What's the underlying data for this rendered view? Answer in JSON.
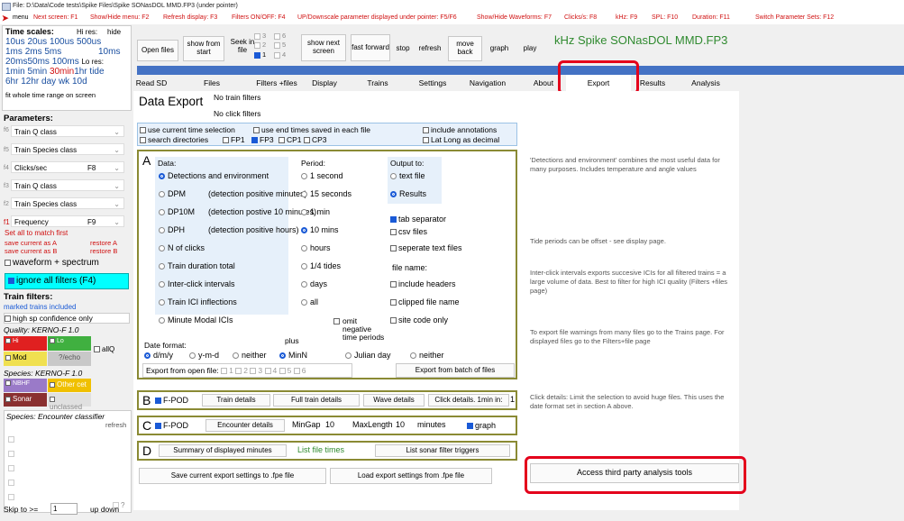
{
  "window_title": "File: D:\\Data\\Code tests\\Spike Files\\Spike SONasDOL MMD.FP3  (under pointer)",
  "menubar": {
    "menu_label": "menu",
    "hints": [
      "Next screen: F1",
      "Show/Hide menu: F2",
      "Refresh display: F3",
      "Filters ON/OFF: F4",
      "UP/Downscale parameter displayed under pointer: F5/F6",
      "Show/Hide Waveforms: F7",
      "Clicks/s: F8",
      "kHz: F9",
      "SPL: F10",
      "Duration: F11",
      "Switch Parameter Sets: F12"
    ]
  },
  "left": {
    "time_scales_label": "Time scales:",
    "hi_res": "Hi res:",
    "hide": "hide",
    "row1": [
      "10us",
      "20us",
      "100us",
      "500us"
    ],
    "row2": [
      "1ms",
      "2ms",
      "5ms",
      "10ms"
    ],
    "row3": [
      "20ms",
      "50ms",
      "100ms",
      "Lo res:"
    ],
    "row4": [
      "1min",
      "5min",
      "30min",
      "1hr",
      "tide"
    ],
    "row5": [
      "6hr",
      "12hr",
      "day",
      "wk",
      "10d"
    ],
    "fit_label": "fit whole time range on screen",
    "parameters_label": "Parameters:",
    "params": [
      {
        "code": "f6",
        "label": "Train Q class",
        "value": ""
      },
      {
        "code": "f5",
        "label": "Train Species class",
        "value": ""
      },
      {
        "code": "f4",
        "label": "Clicks/sec",
        "value": "F8"
      },
      {
        "code": "f3",
        "label": "Train Q class",
        "value": ""
      },
      {
        "code": "f2",
        "label": "Train Species class",
        "value": ""
      },
      {
        "code": "f1",
        "label": "Frequency",
        "value": "F9"
      }
    ],
    "set_all": "Set all to match first",
    "save_a": "save current as A",
    "restore_a": "restore A",
    "save_b": "save current as B",
    "restore_b": "restore B",
    "waveform_spectrum": "waveform + spectrum",
    "ignore_filters": "ignore all filters (F4)",
    "train_filters": "Train filters:",
    "marked_trains": "marked trains included",
    "high_sp": "high sp confidence only",
    "quality": "Quality: KERNO-F 1.0",
    "q_hi": "Hi",
    "q_lo": "Lo",
    "q_mod": "Mod",
    "q_echo": "?/echo",
    "q_all": "allQ",
    "species_kerno": "Species: KERNO-F 1.0",
    "sp_nbhf": "NBHF",
    "sp_other": "Other cet",
    "sp_sonar": "Sonar",
    "sp_unclassed": "unclassed",
    "species_encounter": "Species: Encounter classifier",
    "refresh": "refresh",
    "q_mark": "?",
    "skip_label": "Skip to >=",
    "skip_value": "1",
    "up_down": "up down"
  },
  "toolbar": {
    "open_files": "Open files",
    "show_from_start": "show from start",
    "seek_in_file": "Seek in file",
    "seek_numbers": [
      "3",
      "6",
      "2",
      "5",
      "1",
      "4"
    ],
    "show_next_screen": "show next screen",
    "fast_forward": "fast forward",
    "stop": "stop",
    "refresh": "refresh",
    "move_back": "move back",
    "graph": "graph",
    "play": "play",
    "file_title": "kHz  Spike SONasDOL MMD.FP3"
  },
  "tabs": [
    "Read SD",
    "Files",
    "Filters +files",
    "Display",
    "Trains",
    "Settings",
    "Navigation",
    "About",
    "Export",
    "Results",
    "Analysis"
  ],
  "export": {
    "heading": "Data Export",
    "no_train_filters": "No train filters",
    "no_click_filters": "No click filters",
    "opt_current_time": "use current time selection",
    "opt_end_times": "use end times saved in each file",
    "opt_annotations": "include annotations",
    "opt_search_dirs": "search directories",
    "fp1": "FP1",
    "fp3": "FP3",
    "cp1": "CP1",
    "cp3": "CP3",
    "lat_long": "Lat Long as decimal",
    "section_a": "A",
    "data_label": "Data:",
    "data_options": [
      {
        "label": "Detections and environment",
        "desc": "",
        "selected": true
      },
      {
        "label": "DPM",
        "desc": "(detection positive minutes)",
        "selected": false
      },
      {
        "label": "DP10M",
        "desc": "(detection postive 10 minutes)",
        "selected": false
      },
      {
        "label": "DPH",
        "desc": "(detection positive hours)",
        "selected": false
      },
      {
        "label": "N of clicks",
        "desc": "",
        "selected": false
      },
      {
        "label": "Train duration total",
        "desc": "",
        "selected": false
      },
      {
        "label": "Inter-click intervals",
        "desc": "",
        "selected": false
      },
      {
        "label": "Train ICI inflections",
        "desc": "",
        "selected": false
      },
      {
        "label": "Minute Modal ICIs",
        "desc": "",
        "selected": false
      }
    ],
    "period_label": "Period:",
    "periods": [
      {
        "label": "1 second",
        "selected": false
      },
      {
        "label": "15 seconds",
        "selected": false
      },
      {
        "label": "1 min",
        "selected": false
      },
      {
        "label": "10 mins",
        "selected": true
      },
      {
        "label": "hours",
        "selected": false
      },
      {
        "label": "1/4 tides",
        "selected": false
      },
      {
        "label": "days",
        "selected": false
      },
      {
        "label": "all",
        "selected": false
      }
    ],
    "omit_negative": "omit negative time periods",
    "output_label": "Output to:",
    "out_text_file": "text file",
    "out_results": "Results",
    "tab_separator": "tab separator",
    "csv_files": "csv files",
    "separate_text": "seperate text files",
    "file_name_label": "file name:",
    "include_headers": "include headers",
    "clipped_file_name": "clipped file name",
    "site_code_only": "site code only",
    "date_format_label": "Date format:",
    "plus_label": "plus",
    "df_dmy": "d/m/y",
    "df_ymd": "y-m-d",
    "df_neither": "neither",
    "plus_minn": "MinN",
    "plus_julian": "Julian day",
    "plus_neither": "neither",
    "export_open_label": "Export from open file:",
    "open_file_nums": [
      "1",
      "2",
      "3",
      "4",
      "5",
      "6"
    ],
    "export_batch": "Export from batch of files",
    "section_b": "B",
    "fpod_label": "F-POD",
    "train_details": "Train details",
    "full_train_details": "Full train details",
    "wave_details": "Wave details",
    "click_details": "Click details. 1min in:",
    "click_details_value": "1",
    "section_c": "C",
    "encounter_details": "Encounter details",
    "mingap_label": "MinGap",
    "mingap_value": "10",
    "maxlength_label": "MaxLength",
    "maxlength_value": "10",
    "minutes_label": "minutes",
    "graph_label": "graph",
    "section_d": "D",
    "summary_minutes": "Summary of displayed minutes",
    "list_file_times": "List file times",
    "list_sonar": "List sonar filter triggers",
    "save_settings": "Save current export settings to .fpe file",
    "load_settings": "Load export settings from .fpe file"
  },
  "notes": {
    "n1": "'Detections and environment' combines the most useful data for many purposes. Includes temperature and angle values",
    "n2": "Tide periods can be offset - see display page.",
    "n3": "Inter-click intervals exports succesive ICIs for all filtered trains = a large volume of data. Best to filter for high ICI quality (Filters +files page)",
    "n4": "To export file warnings from many files go to the Trains page. For displayed files go to the Filters+file page",
    "n5": "Click details: Limit the selection to avoid huge files. This uses the date format set in section A above.",
    "third_party": "Access third party analysis tools"
  },
  "colors": {
    "accent_blue": "#1a5ad6",
    "highlight_red": "#e4001b",
    "section_border": "#8a8a34",
    "title_green": "#2f8a2f"
  }
}
